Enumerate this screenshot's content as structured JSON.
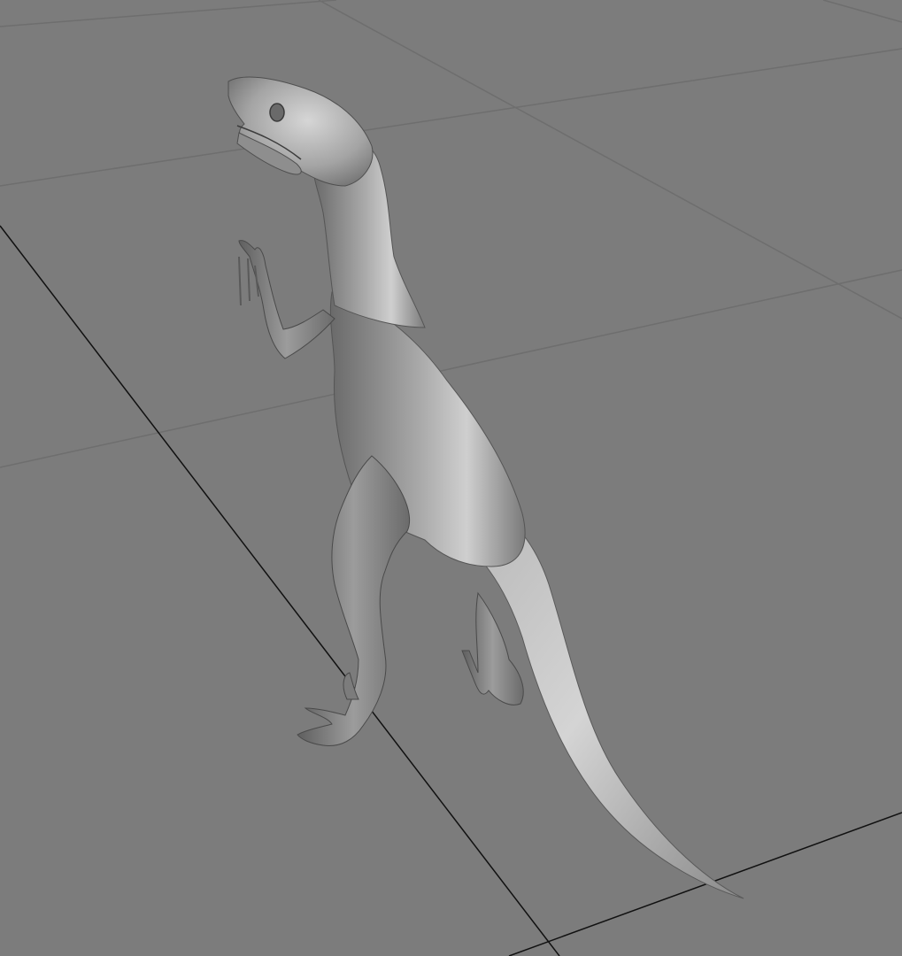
{
  "viewport": {
    "background_color": "#7c7c7c",
    "grid_minor_color": "#6e6e6e",
    "grid_major_color": "#111111",
    "model": {
      "name": "raptor-dinosaur-model",
      "shading": "grey-matcap",
      "base_color": "#9a9a9a"
    }
  }
}
